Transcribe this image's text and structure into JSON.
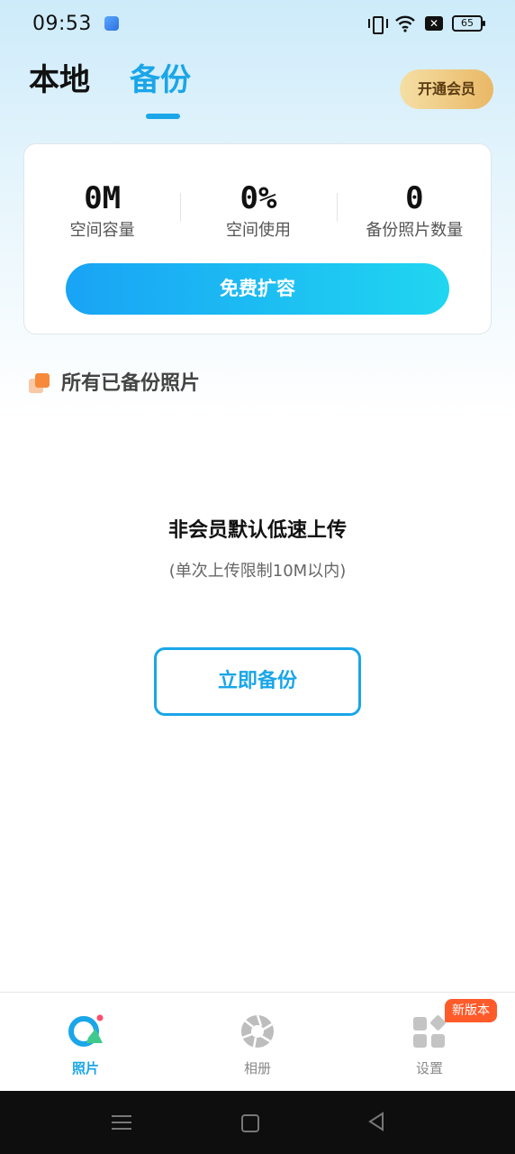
{
  "status_bar": {
    "time": "09:53",
    "battery": "65"
  },
  "header": {
    "tabs": [
      {
        "label": "本地",
        "active": false
      },
      {
        "label": "备份",
        "active": true
      }
    ],
    "vip_button": "开通会员"
  },
  "stats": {
    "items": [
      {
        "value": "0M",
        "label": "空间容量"
      },
      {
        "value": "0%",
        "label": "空间使用"
      },
      {
        "value": "0",
        "label": "备份照片数量"
      }
    ],
    "expand_button": "免费扩容"
  },
  "section": {
    "title": "所有已备份照片"
  },
  "empty_state": {
    "title": "非会员默认低速上传",
    "subtitle": "(单次上传限制10M以内)",
    "button": "立即备份"
  },
  "bottom_nav": {
    "items": [
      {
        "label": "照片",
        "icon": "photos-icon",
        "active": true
      },
      {
        "label": "相册",
        "icon": "album-aperture-icon",
        "active": false
      },
      {
        "label": "设置",
        "icon": "settings-grid-icon",
        "active": false
      }
    ],
    "badge": "新版本"
  },
  "colors": {
    "accent": "#1aa6e8",
    "vip_gold": "#e9b866",
    "badge_red": "#ff5a2a"
  }
}
